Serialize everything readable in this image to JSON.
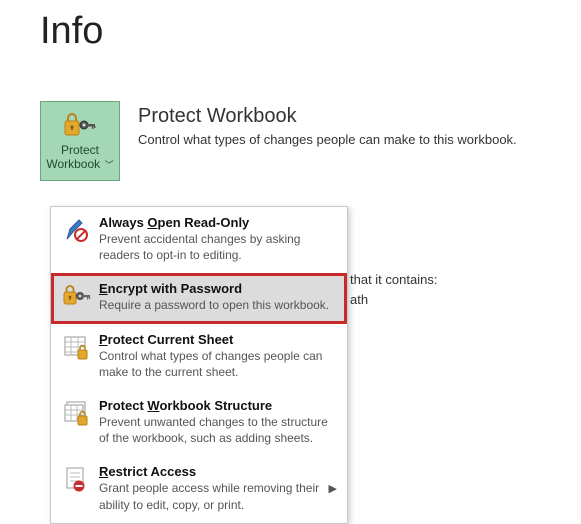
{
  "page": {
    "title": "Info"
  },
  "protect_section": {
    "button_label": "Protect Workbook",
    "heading": "Protect Workbook",
    "description": "Control what types of changes people can make to this workbook."
  },
  "behind": {
    "line1": "that it contains:",
    "line2": "ath"
  },
  "menu": {
    "items": [
      {
        "title_pre": "Always ",
        "title_u": "O",
        "title_post": "pen Read-Only",
        "desc": "Prevent accidental changes by asking readers to opt-in to editing."
      },
      {
        "title_pre": "",
        "title_u": "E",
        "title_post": "ncrypt with Password",
        "desc": "Require a password to open this workbook."
      },
      {
        "title_pre": "",
        "title_u": "P",
        "title_post": "rotect Current Sheet",
        "desc": "Control what types of changes people can make to the current sheet."
      },
      {
        "title_pre": "Protect ",
        "title_u": "W",
        "title_post": "orkbook Structure",
        "desc": "Prevent unwanted changes to the structure of the workbook, such as adding sheets."
      },
      {
        "title_pre": "",
        "title_u": "R",
        "title_post": "estrict Access",
        "desc": "Grant people access while removing their ability to edit, copy, or print."
      }
    ]
  }
}
